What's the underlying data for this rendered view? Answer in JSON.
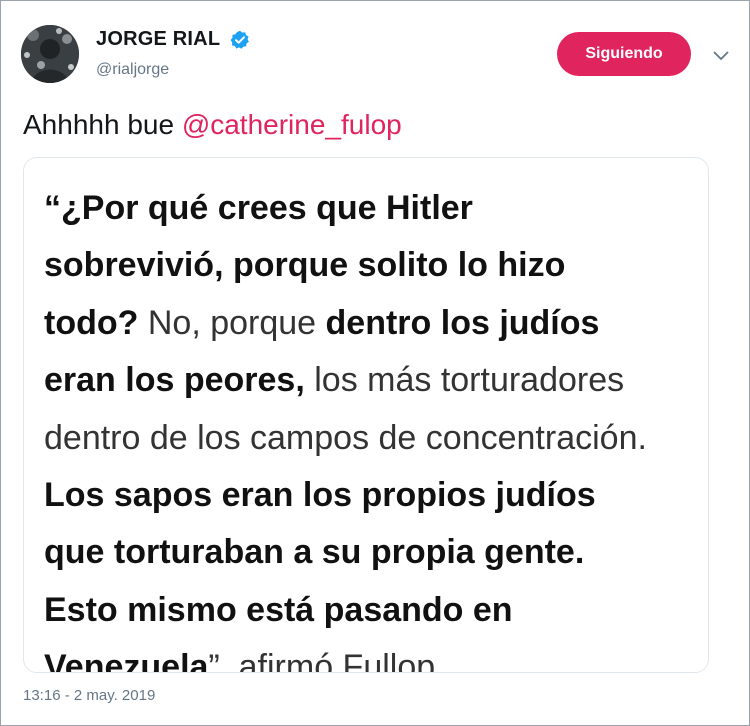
{
  "user": {
    "name": "JORGE RIAL",
    "handle": "@rialjorge",
    "verified": true,
    "avatar_icon": "profile-photo"
  },
  "follow_button": {
    "label": "Siguiendo"
  },
  "menu": {
    "icon": "chevron-down-icon"
  },
  "tweet": {
    "text_prefix": "Ahhhhh bue ",
    "mention": "@catherine_fulop",
    "timestamp": "13:16 - 2 may. 2019"
  },
  "quote_image": {
    "lines": [
      [
        {
          "t": "“¿Por qué crees que Hitler",
          "b": true
        }
      ],
      [
        {
          "t": "sobrevivió, porque solito lo hizo",
          "b": true
        }
      ],
      [
        {
          "t": "todo?",
          "b": true
        },
        {
          "t": " No, porque ",
          "b": false
        },
        {
          "t": "dentro los judíos",
          "b": true
        }
      ],
      [
        {
          "t": "eran los peores,",
          "b": true
        },
        {
          "t": " los más torturadores",
          "b": false
        }
      ],
      [
        {
          "t": "dentro de los campos de concentración.",
          "b": false
        }
      ],
      [
        {
          "t": "Los sapos eran los propios judíos",
          "b": true
        }
      ],
      [
        {
          "t": "que torturaban a su propia gente.",
          "b": true
        }
      ],
      [
        {
          "t": "Esto mismo está pasando en",
          "b": true
        }
      ],
      [
        {
          "t": "Venezuela",
          "b": true
        },
        {
          "t": "”, afirmó Fullop.",
          "b": false
        }
      ]
    ]
  },
  "colors": {
    "follow_button_bg": "#e0245e",
    "mention": "#e0245e",
    "verified_badge": "#1da1f2",
    "secondary_text": "#657786"
  }
}
